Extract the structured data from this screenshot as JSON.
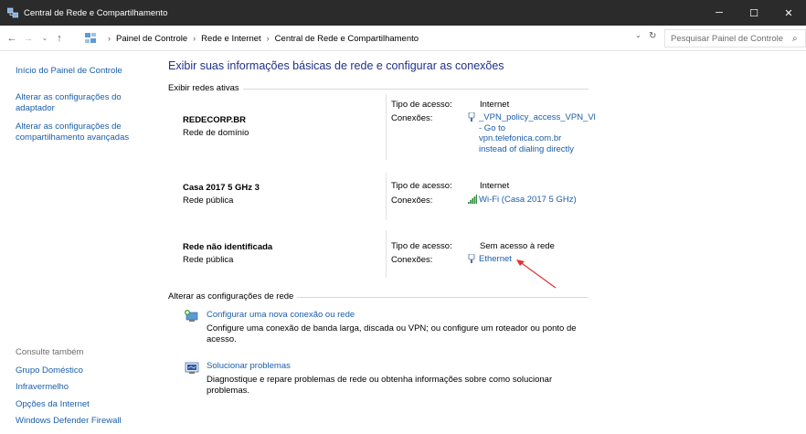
{
  "window": {
    "title": "Central de Rede e Compartilhamento",
    "controls": {
      "minimize": "─",
      "maximize": "☐",
      "close": "✕"
    }
  },
  "address": {
    "back": "←",
    "forward": "→",
    "recent": "⌄",
    "up": "↑",
    "crumbs": [
      "Painel de Controle",
      "Rede e Internet",
      "Central de Rede e Compartilhamento"
    ],
    "separator": "›",
    "dropdown": "⌄",
    "refresh": "↻",
    "search_placeholder": "Pesquisar Painel de Controle",
    "search_glyph": "⌕"
  },
  "left": {
    "home_link": "Início do Painel de Controle",
    "adapter_link": "Alterar as configurações do adaptador",
    "sharing_link": "Alterar as configurações de compartilhamento avançadas",
    "see_also": "Consulte também",
    "see_also_links": [
      "Grupo Doméstico",
      "Infravermelho",
      "Opções da Internet",
      "Windows Defender Firewall"
    ]
  },
  "main": {
    "title": "Exibir suas informações básicas de rede e configurar as conexões",
    "active_networks_label": "Exibir redes ativas",
    "access_label": "Tipo de acesso:",
    "connections_label": "Conexões:",
    "networks": [
      {
        "name": "REDECORP.BR",
        "type": "Rede de domínio",
        "access": "Internet",
        "connection": "_VPN_policy_access_VPN_Vl\n- Go to\nvpn.telefonica.com.br\ninstead of dialing directly",
        "connection_icon": "vpn-adapter-icon"
      },
      {
        "name": "Casa 2017 5 GHz  3",
        "type": "Rede pública",
        "access": "Internet",
        "connection": "Wi-Fi (Casa 2017 5 GHz)",
        "connection_icon": "wifi-signal-icon"
      },
      {
        "name": "Rede não identificada",
        "type": "Rede pública",
        "access": "Sem acesso à rede",
        "connection": "Ethernet",
        "connection_icon": "ethernet-adapter-icon"
      }
    ],
    "change_settings_label": "Alterar as configurações de rede",
    "tasks": [
      {
        "link": "Configurar uma nova conexão ou rede",
        "desc": "Configure uma conexão de banda larga, discada ou VPN; ou configure um roteador ou ponto de acesso.",
        "icon": "new-connection-icon"
      },
      {
        "link": "Solucionar problemas",
        "desc": "Diagnostique e repare problemas de rede ou obtenha informações sobre como solucionar problemas.",
        "icon": "troubleshoot-icon"
      }
    ]
  },
  "colors": {
    "titlebar": "#2b2b2b",
    "link": "#1a5eaa",
    "title_blue": "#1e3287",
    "annotation_arrow": "#e03030"
  }
}
